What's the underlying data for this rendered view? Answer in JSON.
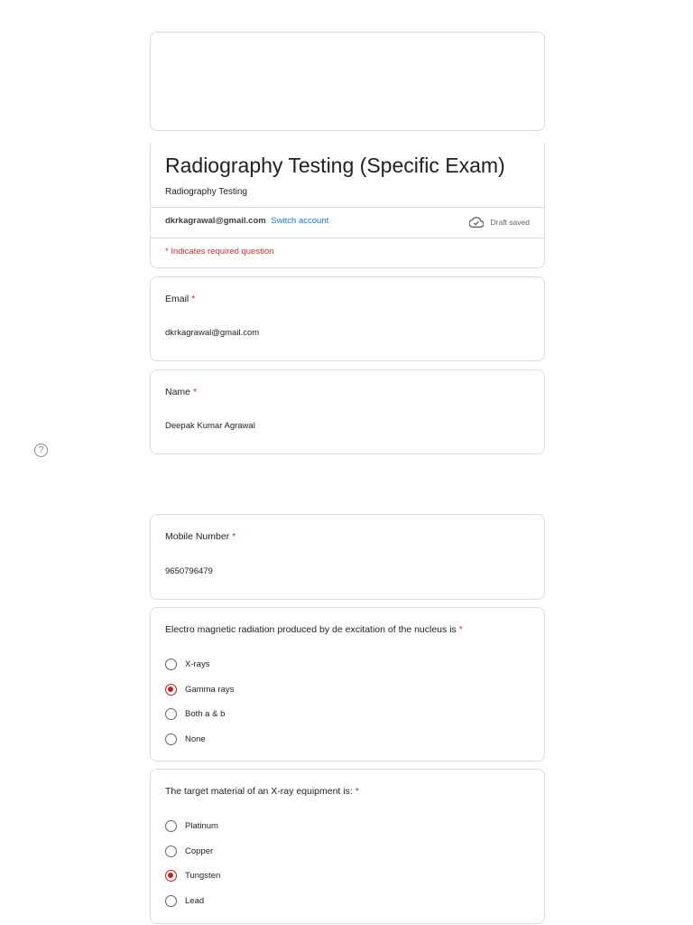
{
  "header": {
    "title": "Radiography Testing (Specific Exam)",
    "description": "Radiography Testing",
    "account_email": "dkrkagrawal@gmail.com",
    "switch_label": "Switch account",
    "draft_status": "Draft saved",
    "required_note": "* Indicates required question"
  },
  "questions": {
    "email": {
      "label": "Email",
      "required": "*",
      "answer": "dkrkagrawal@gmail.com"
    },
    "name": {
      "label": "Name",
      "required": "*",
      "answer": "Deepak Kumar Agrawal"
    },
    "mobile": {
      "label": "Mobile Number",
      "required": "*",
      "answer": "9650796479"
    },
    "em_radiation": {
      "label": "Electro magnetic radiation produced by de excitation of the nucleus is",
      "required": "*",
      "options": [
        "X-rays",
        "Gamma rays",
        "Both a & b",
        "None"
      ],
      "selected": "Gamma rays"
    },
    "target_material": {
      "label": "The target material of an X-ray equipment is:",
      "required": "*",
      "options": [
        "Platinum",
        "Copper",
        "Tungsten",
        "Lead"
      ],
      "selected": "Tungsten"
    }
  },
  "help_icon": "?",
  "colors": {
    "required": "#d93025",
    "link": "#1a73e8",
    "radio_selected": "#c5221f"
  }
}
